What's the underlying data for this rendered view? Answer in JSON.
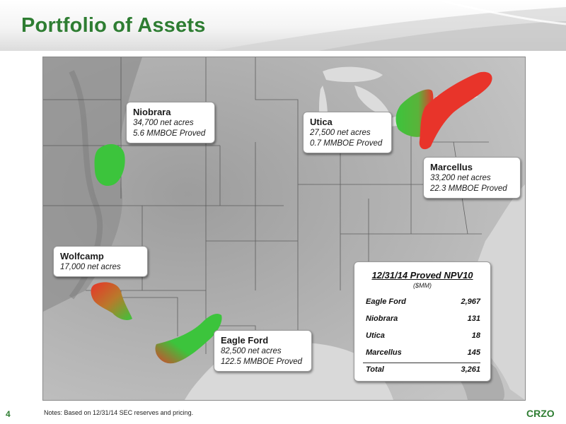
{
  "slide": {
    "title": "Portfolio of Assets",
    "page_number": "4",
    "notes": "Notes:  Based on 12/31/14 SEC reserves and pricing.",
    "brand": "CRZO"
  },
  "colors": {
    "title_green": "#2e7d32",
    "asset_green": "#3cc43c",
    "asset_red": "#e82a2a"
  },
  "assets": [
    {
      "name": "Niobrara",
      "lines": [
        "34,700 net acres",
        "5.6 MMBOE Proved"
      ]
    },
    {
      "name": "Utica",
      "lines": [
        "27,500 net acres",
        "0.7 MMBOE Proved"
      ]
    },
    {
      "name": "Marcellus",
      "lines": [
        "33,200 net acres",
        "22.3 MMBOE Proved"
      ]
    },
    {
      "name": "Wolfcamp",
      "lines": [
        "17,000 net acres"
      ]
    },
    {
      "name": "Eagle Ford",
      "lines": [
        "82,500 net acres",
        "122.5 MMBOE Proved"
      ]
    }
  ],
  "npv_table": {
    "title": "12/31/14 Proved NPV10",
    "subtitle": "($MM)",
    "rows": [
      {
        "label": "Eagle Ford",
        "value": "2,967"
      },
      {
        "label": "Niobrara",
        "value": "131"
      },
      {
        "label": "Utica",
        "value": "18"
      },
      {
        "label": "Marcellus",
        "value": "145"
      }
    ],
    "total": {
      "label": "Total",
      "value": "3,261"
    }
  }
}
